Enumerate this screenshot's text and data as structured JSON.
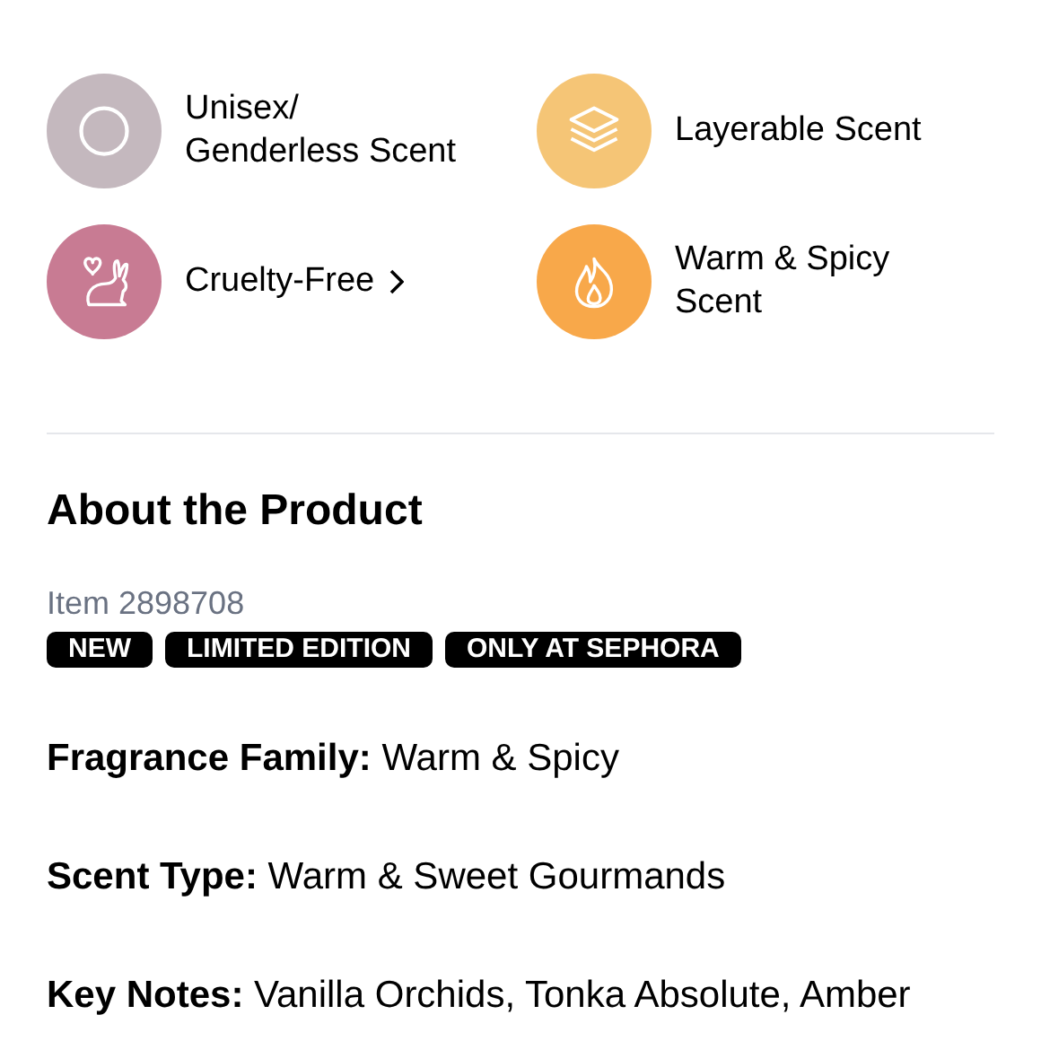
{
  "highlights": [
    {
      "label": "Unisex/ Genderless Scent",
      "color": "#c4b8be",
      "link": false
    },
    {
      "label": "Layerable Scent",
      "color": "#f5c576",
      "link": false
    },
    {
      "label": "Cruelty-Free",
      "color": "#c87b93",
      "link": true
    },
    {
      "label": "Warm & Spicy Scent",
      "color": "#f8a84a",
      "link": false
    }
  ],
  "about": {
    "title": "About the Product",
    "item": "Item 2898708",
    "badges": [
      "NEW",
      "LIMITED EDITION",
      "ONLY AT SEPHORA"
    ],
    "details": [
      "**Fragrance Family:** Warm & Spicy",
      "**Scent Type:** Warm & Sweet Gourmands",
      "**Key Notes:** Vanilla Orchids, Tonka Absolute, Amber"
    ]
  }
}
